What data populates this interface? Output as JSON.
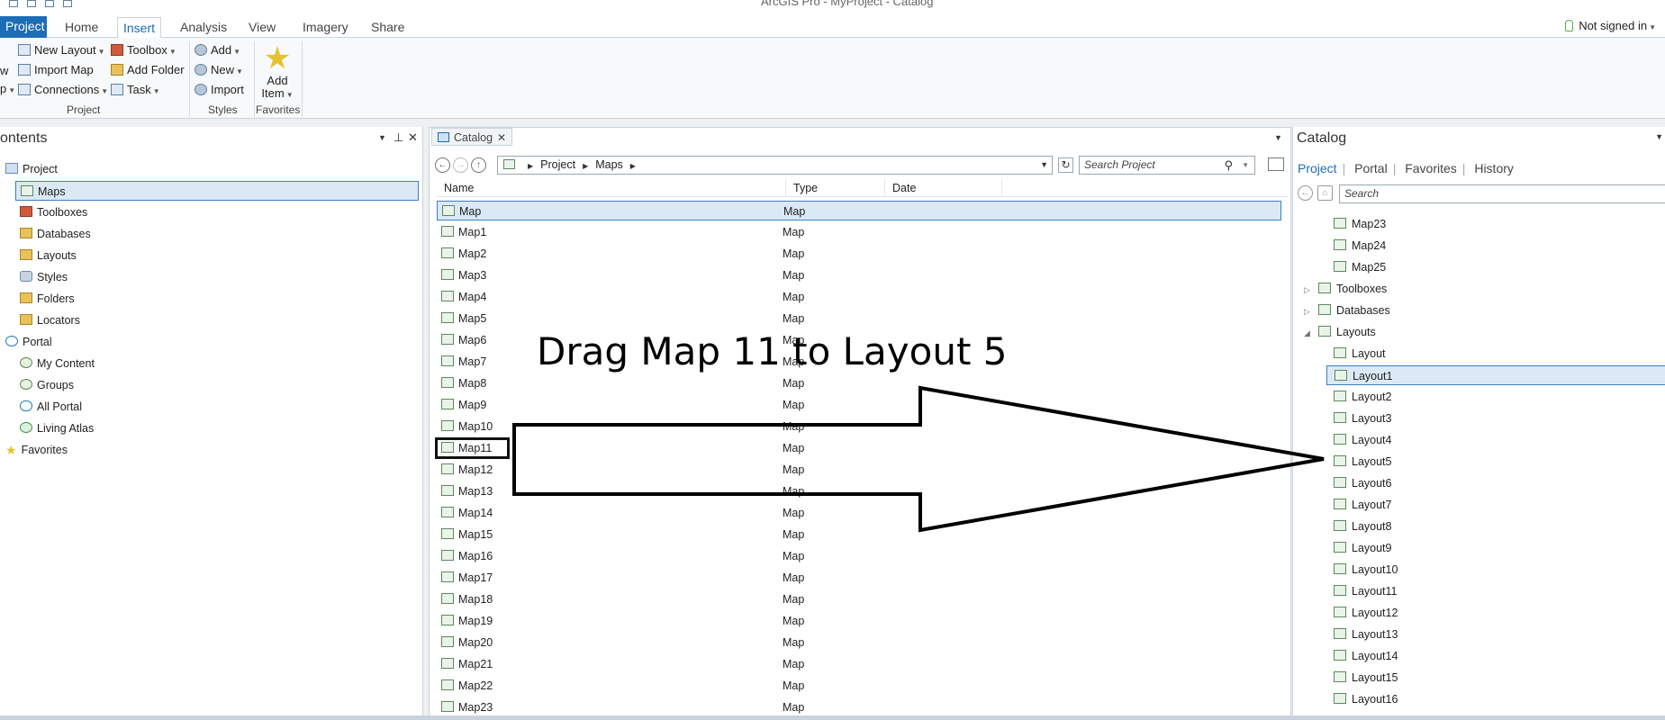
{
  "window": {
    "title": "ArcGIS Pro - MyProject - Catalog"
  },
  "ribbon": {
    "tabs": [
      {
        "label": "Project"
      },
      {
        "label": "Home"
      },
      {
        "label": "Insert"
      },
      {
        "label": "Analysis"
      },
      {
        "label": "View"
      },
      {
        "label": "Imagery"
      },
      {
        "label": "Share"
      }
    ],
    "active_tab": "Insert",
    "sign_in": "Not signed in",
    "project_group": {
      "label": "Project",
      "new_layout": "New Layout",
      "import_map": "Import Map",
      "connections": "Connections",
      "toolbox": "Toolbox",
      "add_folder": "Add Folder",
      "task": "Task",
      "new_map_partial": "w",
      "map_partial": "p"
    },
    "styles_group": {
      "label": "Styles",
      "add": "Add",
      "new": "New",
      "import": "Import"
    },
    "favorites_group": {
      "label": "Favorites",
      "add_item_line1": "Add",
      "add_item_line2": "Item"
    }
  },
  "contents_pane": {
    "title": "ontents",
    "tree": [
      {
        "label": "Project",
        "icon": "project-icon",
        "level": 0
      },
      {
        "label": "Maps",
        "icon": "maps-folder-icon",
        "level": 1,
        "selected": true
      },
      {
        "label": "Toolboxes",
        "icon": "toolbox-icon",
        "level": 1
      },
      {
        "label": "Databases",
        "icon": "database-icon",
        "level": 1
      },
      {
        "label": "Layouts",
        "icon": "layouts-folder-icon",
        "level": 1
      },
      {
        "label": "Styles",
        "icon": "styles-icon",
        "level": 1
      },
      {
        "label": "Folders",
        "icon": "folder-icon",
        "level": 1
      },
      {
        "label": "Locators",
        "icon": "locator-icon",
        "level": 1
      },
      {
        "label": "Portal",
        "icon": "portal-icon",
        "level": 0
      },
      {
        "label": "My Content",
        "icon": "my-content-icon",
        "level": 1
      },
      {
        "label": "Groups",
        "icon": "groups-icon",
        "level": 1
      },
      {
        "label": "All Portal",
        "icon": "cloud-icon",
        "level": 1
      },
      {
        "label": "Living Atlas",
        "icon": "globe-icon",
        "level": 1
      },
      {
        "label": "Favorites",
        "icon": "star-icon",
        "level": 0
      }
    ]
  },
  "catalog_view": {
    "tab_label": "Catalog",
    "path": [
      "Project",
      "Maps"
    ],
    "search_placeholder": "Search Project",
    "columns": [
      "Name",
      "Type",
      "Date"
    ],
    "rows": [
      {
        "name": "Map",
        "type": "Map",
        "selected": true
      },
      {
        "name": "Map1",
        "type": "Map"
      },
      {
        "name": "Map2",
        "type": "Map"
      },
      {
        "name": "Map3",
        "type": "Map"
      },
      {
        "name": "Map4",
        "type": "Map"
      },
      {
        "name": "Map5",
        "type": "Map"
      },
      {
        "name": "Map6",
        "type": "Map"
      },
      {
        "name": "Map7",
        "type": "Map"
      },
      {
        "name": "Map8",
        "type": "Map"
      },
      {
        "name": "Map9",
        "type": "Map"
      },
      {
        "name": "Map10",
        "type": "Map"
      },
      {
        "name": "Map11",
        "type": "Map",
        "highlight": true
      },
      {
        "name": "Map12",
        "type": "Map"
      },
      {
        "name": "Map13",
        "type": "Map"
      },
      {
        "name": "Map14",
        "type": "Map"
      },
      {
        "name": "Map15",
        "type": "Map"
      },
      {
        "name": "Map16",
        "type": "Map"
      },
      {
        "name": "Map17",
        "type": "Map"
      },
      {
        "name": "Map18",
        "type": "Map"
      },
      {
        "name": "Map19",
        "type": "Map"
      },
      {
        "name": "Map20",
        "type": "Map"
      },
      {
        "name": "Map21",
        "type": "Map"
      },
      {
        "name": "Map22",
        "type": "Map"
      },
      {
        "name": "Map23",
        "type": "Map"
      }
    ]
  },
  "catalog_pane": {
    "title": "Catalog",
    "tabs": [
      "Project",
      "Portal",
      "Favorites",
      "History"
    ],
    "active_tab": "Project",
    "search_placeholder": "Search",
    "items": [
      {
        "label": "Map23",
        "kind": "map",
        "level": 2
      },
      {
        "label": "Map24",
        "kind": "map",
        "level": 2
      },
      {
        "label": "Map25",
        "kind": "map",
        "level": 2
      },
      {
        "label": "Toolboxes",
        "kind": "toolbox",
        "level": 1,
        "expander": "collapsed"
      },
      {
        "label": "Databases",
        "kind": "database",
        "level": 1,
        "expander": "collapsed"
      },
      {
        "label": "Layouts",
        "kind": "layouts-folder",
        "level": 1,
        "expander": "expanded"
      },
      {
        "label": "Layout",
        "kind": "layout",
        "level": 2
      },
      {
        "label": "Layout1",
        "kind": "layout",
        "level": 2,
        "selected": true
      },
      {
        "label": "Layout2",
        "kind": "layout",
        "level": 2
      },
      {
        "label": "Layout3",
        "kind": "layout",
        "level": 2
      },
      {
        "label": "Layout4",
        "kind": "layout",
        "level": 2
      },
      {
        "label": "Layout5",
        "kind": "layout",
        "level": 2
      },
      {
        "label": "Layout6",
        "kind": "layout",
        "level": 2
      },
      {
        "label": "Layout7",
        "kind": "layout",
        "level": 2
      },
      {
        "label": "Layout8",
        "kind": "layout",
        "level": 2
      },
      {
        "label": "Layout9",
        "kind": "layout",
        "level": 2
      },
      {
        "label": "Layout10",
        "kind": "layout",
        "level": 2
      },
      {
        "label": "Layout11",
        "kind": "layout",
        "level": 2
      },
      {
        "label": "Layout12",
        "kind": "layout",
        "level": 2
      },
      {
        "label": "Layout13",
        "kind": "layout",
        "level": 2
      },
      {
        "label": "Layout14",
        "kind": "layout",
        "level": 2
      },
      {
        "label": "Layout15",
        "kind": "layout",
        "level": 2
      },
      {
        "label": "Layout16",
        "kind": "layout",
        "level": 2
      }
    ]
  },
  "annotation": {
    "text": "Drag Map 11 to Layout 5"
  },
  "colors": {
    "accent": "#1c6db5",
    "selection_bg": "#dbe9f6",
    "selection_border": "#3b7fc4",
    "star": "#e6c230"
  }
}
